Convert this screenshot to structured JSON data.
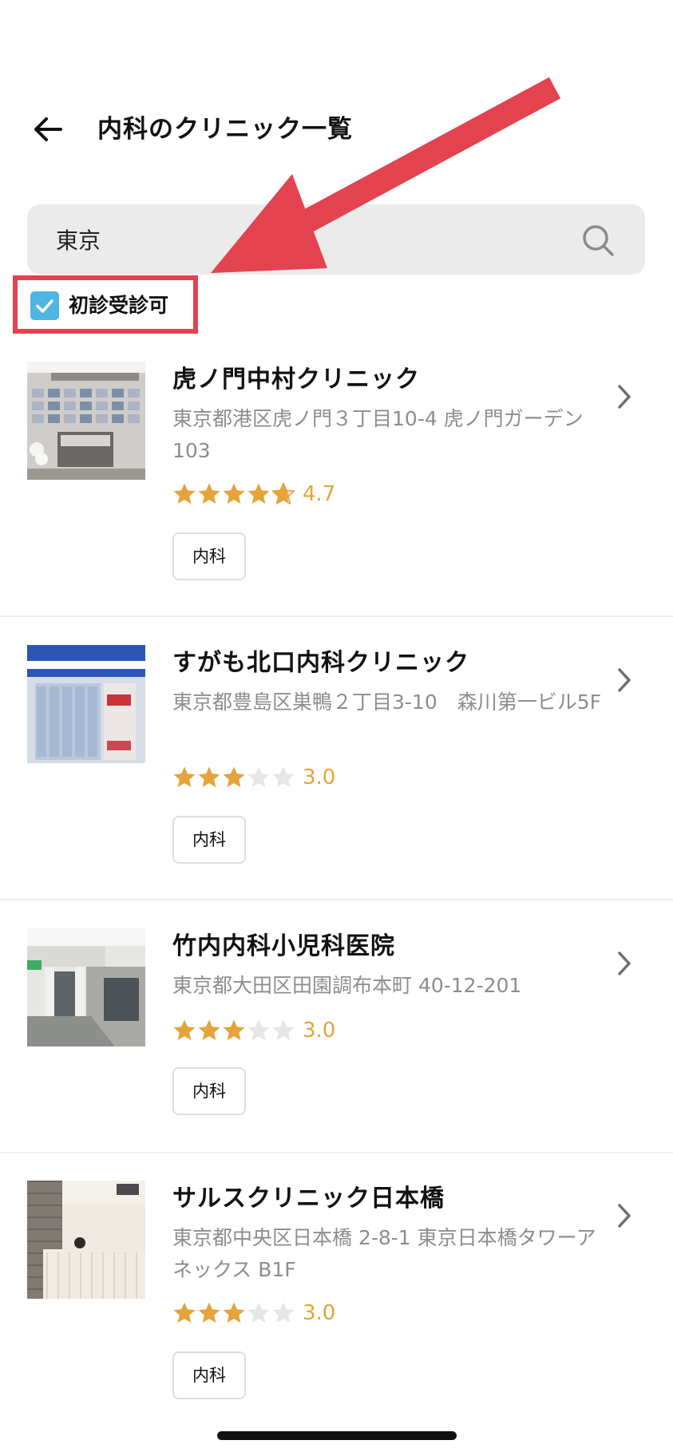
{
  "header": {
    "title": "内科のクリニック一覧",
    "back_icon": "arrow-left-icon"
  },
  "search": {
    "value": "東京",
    "icon": "search-icon"
  },
  "filter": {
    "label": "初診受診可",
    "checked": true,
    "check_color": "#4fb6e4"
  },
  "annotation": {
    "highlight_color": "#e2434f"
  },
  "colors": {
    "star_filled": "#e5a33a",
    "star_empty": "#e6e6e6",
    "address": "#8d8d8d"
  },
  "clinics": [
    {
      "name": "虎ノ門中村クリニック",
      "address": "東京都港区虎ノ門３丁目10-4 虎ノ門ガーデン103",
      "rating": 4.7,
      "rating_text": "4.7",
      "tag": "内科"
    },
    {
      "name": "すがも北口内科クリニック",
      "address": "東京都豊島区巣鴨２丁目3-10　森川第一ビル5F",
      "rating": 3.0,
      "rating_text": "3.0",
      "tag": "内科"
    },
    {
      "name": "竹内内科小児科医院",
      "address": "東京都大田区田園調布本町 40-12-201",
      "rating": 3.0,
      "rating_text": "3.0",
      "tag": "内科"
    },
    {
      "name": "サルスクリニック日本橋",
      "address": "東京都中央区日本橋 2-8-1 東京日本橋タワーアネックス B1F",
      "rating": 3.0,
      "rating_text": "3.0",
      "tag": "内科"
    }
  ]
}
